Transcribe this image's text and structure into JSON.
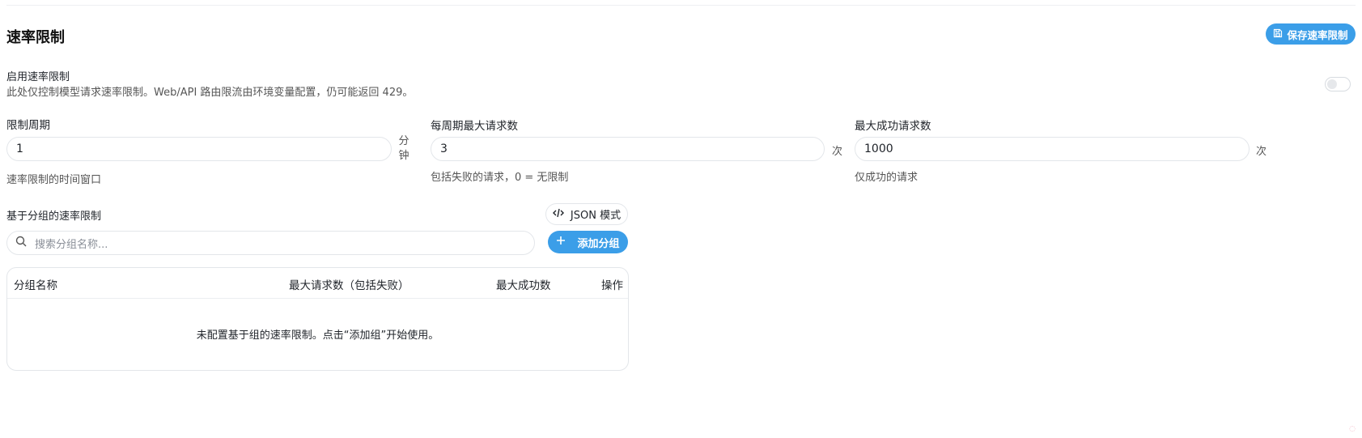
{
  "section": {
    "title": "速率限制",
    "save_label": "保存速率限制"
  },
  "enable": {
    "label": "启用速率限制",
    "description": "此处仅控制模型请求速率限制。Web/API 路由限流由环境变量配置，仍可能返回 429。",
    "enabled": false
  },
  "fields": {
    "period": {
      "label": "限制周期",
      "value": "1",
      "unit": "分钟",
      "unit_chars": [
        "分",
        "钟"
      ],
      "hint": "速率限制的时间窗口"
    },
    "max_requests": {
      "label": "每周期最大请求数",
      "value": "3",
      "unit": "次",
      "hint": "包括失败的请求，0 = 无限制"
    },
    "max_success": {
      "label": "最大成功请求数",
      "value": "1000",
      "unit": "次",
      "hint": "仅成功的请求"
    }
  },
  "groups": {
    "title": "基于分组的速率限制",
    "json_mode_label": "JSON 模式",
    "search_placeholder": "搜索分组名称...",
    "add_label": "添加分组",
    "columns": [
      "分组名称",
      "最大请求数（包括失败）",
      "最大成功数",
      "操作"
    ],
    "empty_text": "未配置基于组的速率限制。点击“添加组”开始使用。"
  },
  "colors": {
    "accent": "#3b9ee8",
    "border": "#e3e6ea"
  },
  "icons": [
    "save-icon",
    "code-icon",
    "search-icon",
    "plus-icon"
  ]
}
